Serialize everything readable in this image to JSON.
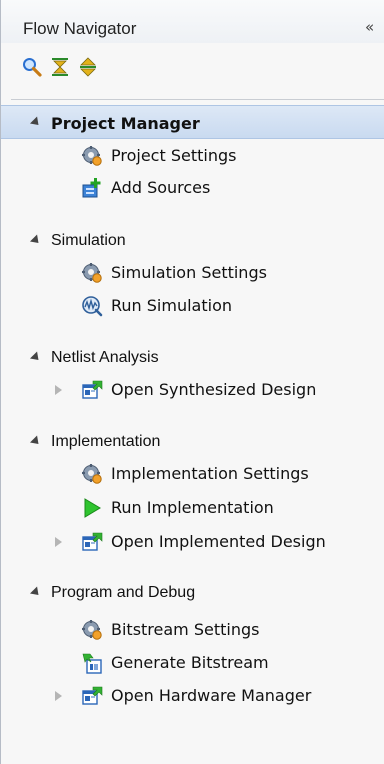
{
  "panel": {
    "title": "Flow Navigator",
    "collapse_glyph": "«"
  },
  "toolbar": {
    "icons": [
      "search-icon",
      "collapse-all-icon",
      "expand-all-icon"
    ]
  },
  "sections": [
    {
      "label": "Project Manager",
      "selected": true,
      "items": [
        {
          "label": "Project Settings",
          "icon": "gear-settings-icon"
        },
        {
          "label": "Add Sources",
          "icon": "add-sources-icon"
        }
      ]
    },
    {
      "label": "Simulation",
      "items": [
        {
          "label": "Simulation Settings",
          "icon": "gear-settings-icon"
        },
        {
          "label": "Run Simulation",
          "icon": "waveform-icon"
        }
      ]
    },
    {
      "label": "Netlist Analysis",
      "items": [
        {
          "label": "Open Synthesized Design",
          "icon": "open-design-icon",
          "expandable": true
        }
      ]
    },
    {
      "label": "Implementation",
      "items": [
        {
          "label": "Implementation Settings",
          "icon": "gear-settings-icon"
        },
        {
          "label": "Run Implementation",
          "icon": "run-play-icon"
        },
        {
          "label": "Open Implemented Design",
          "icon": "open-design-icon",
          "expandable": true
        }
      ]
    },
    {
      "label": "Program and Debug",
      "items": [
        {
          "label": "Bitstream Settings",
          "icon": "gear-settings-icon"
        },
        {
          "label": "Generate Bitstream",
          "icon": "generate-bitstream-icon"
        },
        {
          "label": "Open Hardware Manager",
          "icon": "open-design-icon",
          "expandable": true
        }
      ]
    }
  ]
}
